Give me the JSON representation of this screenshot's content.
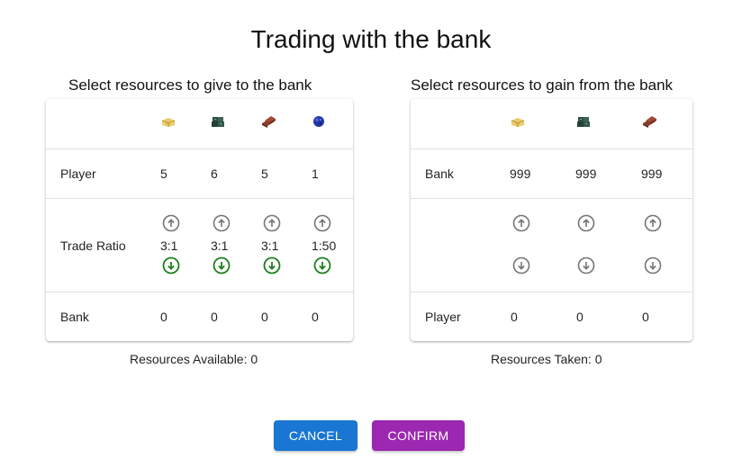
{
  "dialog": {
    "title": "Trading with the bank",
    "cancel_label": "CANCEL",
    "confirm_label": "CONFIRM",
    "colors": {
      "cancel": "#1976d2",
      "confirm": "#9c27b0",
      "arrow_up": "#757575",
      "arrow_down_active": "#1b7f1b",
      "arrow_down_inactive": "#757575"
    }
  },
  "give": {
    "heading": "Select resources to give to the bank",
    "resources": [
      {
        "icon": "hay-bale-icon"
      },
      {
        "icon": "ore-pile-icon"
      },
      {
        "icon": "brick-stack-icon"
      },
      {
        "icon": "sheep-wool-icon"
      }
    ],
    "player_label": "Player",
    "player_values": [
      "5",
      "6",
      "5",
      "1"
    ],
    "ratio_label": "Trade Ratio",
    "ratios": [
      "3:1",
      "3:1",
      "3:1",
      "1:50"
    ],
    "bank_label": "Bank",
    "bank_values": [
      "0",
      "0",
      "0",
      "0"
    ],
    "footer": "Resources Available: 0"
  },
  "gain": {
    "heading": "Select resources to gain from the bank",
    "resources": [
      {
        "icon": "hay-bale-icon"
      },
      {
        "icon": "ore-pile-icon"
      },
      {
        "icon": "brick-stack-icon"
      }
    ],
    "bank_label": "Bank",
    "bank_values": [
      "999",
      "999",
      "999"
    ],
    "player_label": "Player",
    "player_values": [
      "0",
      "0",
      "0"
    ],
    "footer": "Resources Taken: 0"
  }
}
